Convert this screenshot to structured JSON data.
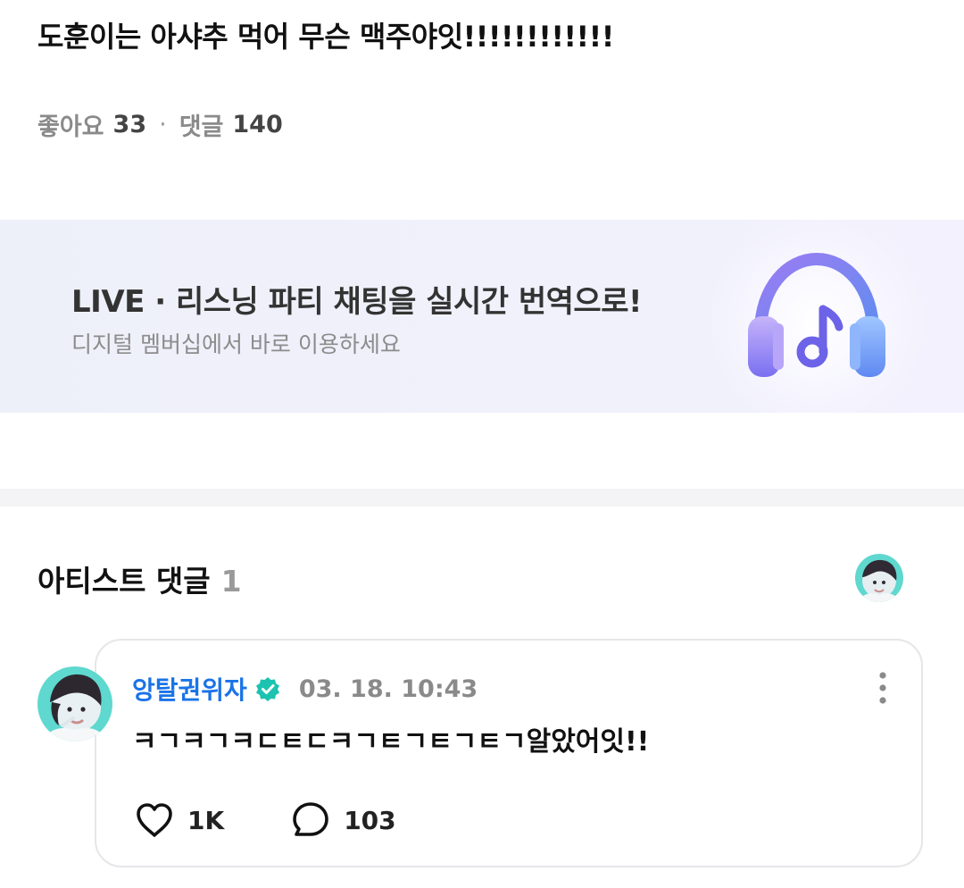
{
  "post": {
    "title": "도훈이는 아샤추 먹어 무슨 맥주야잇!!!!!!!!!!!!",
    "likes_label": "좋아요",
    "likes_count": "33",
    "separator": "·",
    "comments_label": "댓글",
    "comments_count": "140"
  },
  "banner": {
    "title": "LIVE · 리스닝 파티 채팅을 실시간 번역으로!",
    "subtitle": "디지털 멤버십에서 바로 이용하세요",
    "icon": "headphones-music-icon"
  },
  "artist_comments": {
    "heading": "아티스트 댓글",
    "count": "1"
  },
  "comment": {
    "author": "앙탈권위자",
    "verified_icon": "verified-badge-icon",
    "timestamp": "03. 18. 10:43",
    "text": "ㅋㄱㅋㄱㅋㄷㅌㄷㅋㄱㅌㄱㅌㄱㅌㄱ알았어잇!!",
    "like_count": "1K",
    "reply_count": "103"
  },
  "colors": {
    "accent_blue": "#1a73e8",
    "verified_teal": "#1cc3b0",
    "muted_gray": "#8a8a8a"
  }
}
